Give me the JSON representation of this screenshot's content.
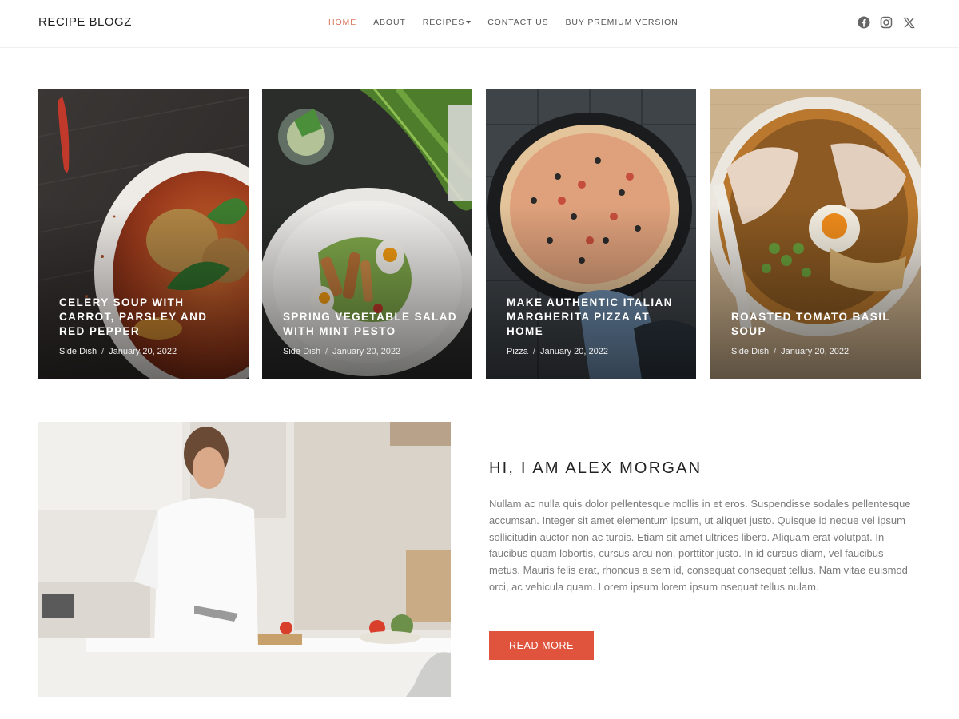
{
  "site": {
    "logo": "RECIPE BLOGZ"
  },
  "nav": {
    "items": [
      {
        "label": "HOME",
        "active": true
      },
      {
        "label": "ABOUT"
      },
      {
        "label": "RECIPES",
        "has_dropdown": true
      },
      {
        "label": "CONTACT US"
      },
      {
        "label": "BUY PREMIUM VERSION"
      }
    ]
  },
  "social": [
    "facebook-icon",
    "instagram-icon",
    "x-icon"
  ],
  "featured": [
    {
      "title": "CELERY SOUP WITH CARROT, PARSLEY AND RED PEPPER",
      "category": "Side Dish",
      "date": "January 20, 2022"
    },
    {
      "title": "SPRING VEGETABLE SALAD WITH MINT PESTO",
      "category": "Side Dish",
      "date": "January 20, 2022"
    },
    {
      "title": "MAKE AUTHENTIC ITALIAN MARGHERITA PIZZA AT HOME",
      "category": "Pizza",
      "date": "January 20, 2022"
    },
    {
      "title": "ROASTED TOMATO BASIL SOUP",
      "category": "Side Dish",
      "date": "January 20, 2022"
    }
  ],
  "about": {
    "title": "HI, I AM ALEX MORGAN",
    "body": "Nullam ac nulla quis dolor pellentesque mollis in et eros. Suspendisse sodales pellentesque accumsan. Integer sit amet elementum ipsum, ut aliquet justo. Quisque id neque vel ipsum sollicitudin auctor non ac turpis. Etiam sit amet ultrices libero. Aliquam erat volutpat. In faucibus quam lobortis, cursus arcu non, porttitor justo. In id cursus diam, vel faucibus metus. Mauris felis erat, rhoncus a sem id, consequat consequat tellus. Nam vitae euismod orci, ac vehicula quam. Lorem ipsum lorem ipsum nsequat tellus nulam.",
    "button": "READ MORE"
  },
  "colors": {
    "accent": "#e0533d",
    "nav_active": "#d9765b"
  }
}
